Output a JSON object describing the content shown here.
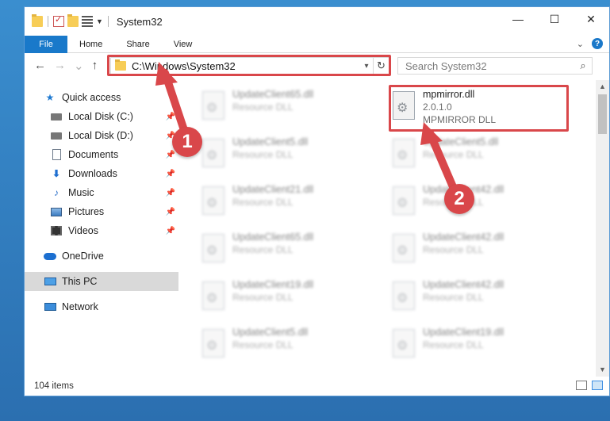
{
  "window": {
    "title": "System32",
    "controls": {
      "minimize": "—",
      "maximize": "☐",
      "close": "✕"
    }
  },
  "ribbon": {
    "tabs": [
      "File",
      "Home",
      "Share",
      "View"
    ],
    "help_icon": "?"
  },
  "navigation": {
    "back_icon": "←",
    "forward_icon": "→",
    "recent_icon": "⌄",
    "up_icon": "↑",
    "address": "C:\\Windows\\System32",
    "refresh_icon": "↻",
    "search_placeholder": "Search System32",
    "search_icon": "⌕"
  },
  "sidebar": {
    "items": [
      {
        "label": "Quick access",
        "icon": "star-icon"
      },
      {
        "label": "Local Disk (C:)",
        "icon": "drive-icon",
        "pinned": true
      },
      {
        "label": "Local Disk (D:)",
        "icon": "drive-icon",
        "pinned": true
      },
      {
        "label": "Documents",
        "icon": "documents-icon",
        "pinned": true
      },
      {
        "label": "Downloads",
        "icon": "downloads-icon",
        "pinned": true
      },
      {
        "label": "Music",
        "icon": "music-icon",
        "pinned": true
      },
      {
        "label": "Pictures",
        "icon": "pictures-icon",
        "pinned": true
      },
      {
        "label": "Videos",
        "icon": "videos-icon",
        "pinned": true
      },
      {
        "label": "OneDrive",
        "icon": "cloud-icon"
      },
      {
        "label": "This PC",
        "icon": "computer-icon",
        "selected": true
      },
      {
        "label": "Network",
        "icon": "network-icon"
      }
    ]
  },
  "files": {
    "highlighted": {
      "name": "mpmirror.dll",
      "version": "2.0.1.0",
      "description": "MPMIRROR DLL"
    },
    "left_column": [
      {
        "name": "UpdateClient65.dll",
        "type": "Resource DLL"
      },
      {
        "name": "UpdateClient5.dll",
        "type": "Resource DLL"
      },
      {
        "name": "UpdateClient21.dll",
        "type": "Resource DLL"
      },
      {
        "name": "UpdateClient65.dll",
        "type": "Resource DLL"
      },
      {
        "name": "UpdateClient19.dll",
        "type": "Resource DLL"
      },
      {
        "name": "UpdateClient5.dll",
        "type": "Resource DLL"
      }
    ],
    "right_column": [
      {
        "name": "UpdateClient5.dll",
        "type": "Resource DLL"
      },
      {
        "name": "UpdateClient42.dll",
        "type": "Resource DLL"
      },
      {
        "name": "UpdateClient42.dll",
        "type": "Resource DLL"
      },
      {
        "name": "UpdateClient42.dll",
        "type": "Resource DLL"
      },
      {
        "name": "UpdateClient19.dll",
        "type": "Resource DLL"
      }
    ]
  },
  "status": {
    "item_count": "104 items"
  },
  "annotations": {
    "step1": "1",
    "step2": "2",
    "color": "#d9474a"
  }
}
